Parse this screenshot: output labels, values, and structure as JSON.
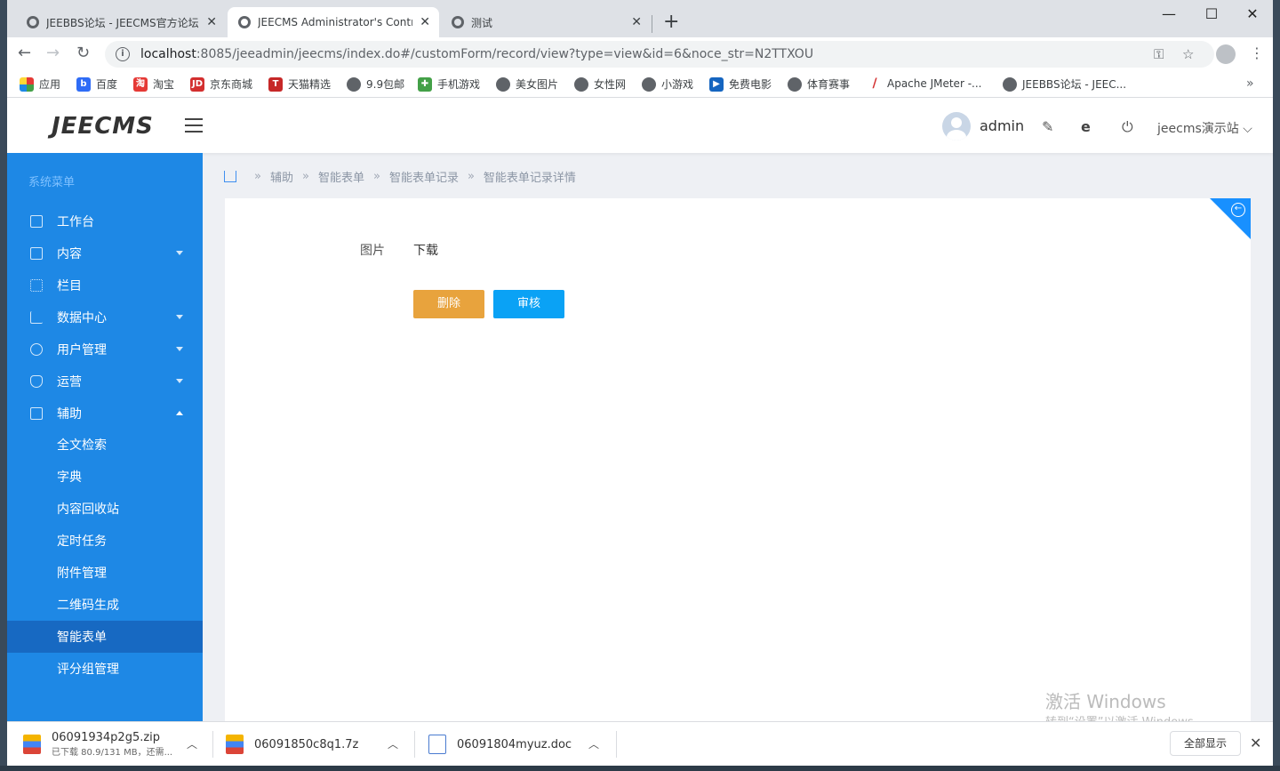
{
  "browser": {
    "tabs": [
      {
        "title": "JEEBBS论坛 - JEECMS官方论坛",
        "active": false
      },
      {
        "title": "JEECMS Administrator's Control",
        "active": true
      },
      {
        "title": "测试",
        "active": false
      }
    ],
    "url_host": "localhost",
    "url_path": ":8085/jeeadmin/jeecms/index.do#/customForm/record/view?type=view&id=6&noce_str=N2TTXOU",
    "bookmarks": [
      "应用",
      "百度",
      "淘宝",
      "京东商城",
      "天猫精选",
      "9.9包邮",
      "手机游戏",
      "美女图片",
      "女性网",
      "小游戏",
      "免费电影",
      "体育赛事",
      "Apache JMeter -...",
      "JEEBBS论坛 - JEEC..."
    ]
  },
  "header": {
    "logo": "JEECMS",
    "user": "admin",
    "site": "jeecms演示站"
  },
  "sidebar": {
    "title": "系统菜单",
    "items": [
      {
        "label": "工作台",
        "caret": false
      },
      {
        "label": "内容",
        "caret": true
      },
      {
        "label": "栏目",
        "caret": false
      },
      {
        "label": "数据中心",
        "caret": true
      },
      {
        "label": "用户管理",
        "caret": true
      },
      {
        "label": "运营",
        "caret": true
      },
      {
        "label": "辅助",
        "caret": true,
        "expanded": true
      }
    ],
    "subitems": [
      "全文检索",
      "字典",
      "内容回收站",
      "定时任务",
      "附件管理",
      "二维码生成",
      "智能表单",
      "评分组管理"
    ],
    "active_sub": "智能表单"
  },
  "breadcrumb": [
    "辅助",
    "智能表单",
    "智能表单记录",
    "智能表单记录详情"
  ],
  "detail": {
    "field_label": "图片",
    "field_value": "下载",
    "delete_label": "删除",
    "audit_label": "审核"
  },
  "watermark": {
    "line1": "激活 Windows",
    "line2": "转到“设置”以激活 Windows。"
  },
  "downloads": {
    "items": [
      {
        "name": "06091934p2g5.zip",
        "status": "已下载 80.9/131 MB，还需..."
      },
      {
        "name": "06091850c8q1.7z",
        "status": ""
      },
      {
        "name": "06091804myuz.doc",
        "status": ""
      }
    ],
    "show_all": "全部显示"
  }
}
